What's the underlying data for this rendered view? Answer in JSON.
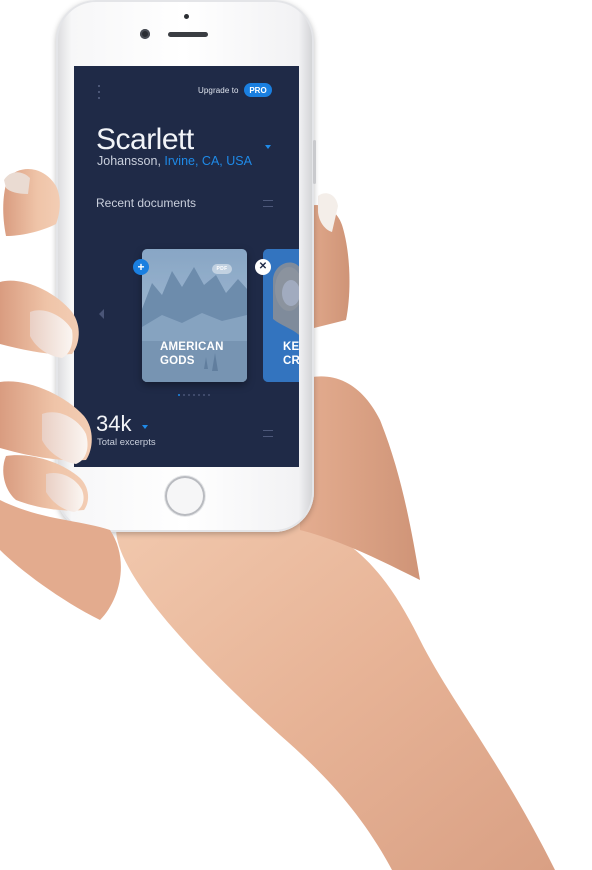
{
  "header": {
    "menu_icon": "vertical-dots-icon",
    "upgrade_label": "Upgrade to",
    "pro_badge": "PRO"
  },
  "profile": {
    "first_name": "Scarlett",
    "last_name": "Johansson,",
    "location": "Irvine, CA, USA",
    "chevron_icon": "chevron-down-icon"
  },
  "recent": {
    "title": "Recent documents",
    "menu_icon": "hamburger-icon",
    "cards": [
      {
        "title_line1": "AMERICAN",
        "title_line2": "GODS",
        "type": "PDF"
      },
      {
        "title_line1": "KE",
        "title_line2": "CR"
      }
    ],
    "pager_count": 7,
    "pager_active": 1
  },
  "stats": {
    "value": "34k",
    "label": "Total excerpts",
    "menu_icon": "hamburger-icon"
  },
  "colors": {
    "screen_bg": "#1f2a47",
    "accent": "#1a7fe0",
    "text": "#f2f4f8"
  }
}
